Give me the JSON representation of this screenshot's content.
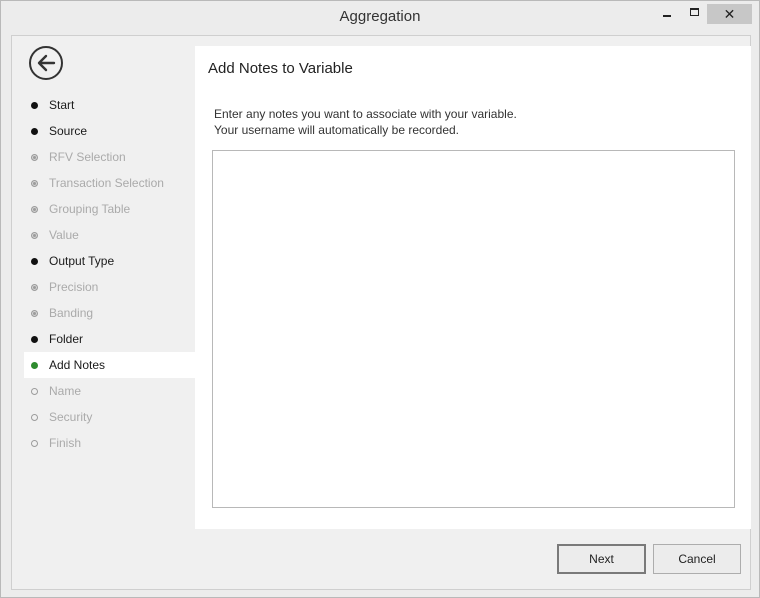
{
  "window": {
    "title": "Aggregation"
  },
  "titlebar_buttons": {
    "minimize": "–",
    "maximize": "□",
    "close": "✕"
  },
  "steps": [
    {
      "label": "Start",
      "state": "done"
    },
    {
      "label": "Source",
      "state": "done"
    },
    {
      "label": "RFV Selection",
      "state": "disabled"
    },
    {
      "label": "Transaction Selection",
      "state": "disabled"
    },
    {
      "label": "Grouping Table",
      "state": "disabled"
    },
    {
      "label": "Value",
      "state": "disabled"
    },
    {
      "label": "Output Type",
      "state": "done"
    },
    {
      "label": "Precision",
      "state": "disabled"
    },
    {
      "label": "Banding",
      "state": "disabled"
    },
    {
      "label": "Folder",
      "state": "done"
    },
    {
      "label": "Add Notes",
      "state": "active"
    },
    {
      "label": "Name",
      "state": "future"
    },
    {
      "label": "Security",
      "state": "future"
    },
    {
      "label": "Finish",
      "state": "future"
    }
  ],
  "panel": {
    "title": "Add Notes to Variable",
    "instruction_line1": "Enter any notes you want to associate with your variable.",
    "instruction_line2": "Your username will automatically be recorded.",
    "notes_value": ""
  },
  "footer": {
    "next_label": "Next",
    "cancel_label": "Cancel"
  },
  "colors": {
    "active_dot": "#2e8b2e",
    "done_dot": "#111111",
    "disabled_text": "#aaaaaa"
  },
  "icons": {
    "back": "back-arrow-icon"
  }
}
